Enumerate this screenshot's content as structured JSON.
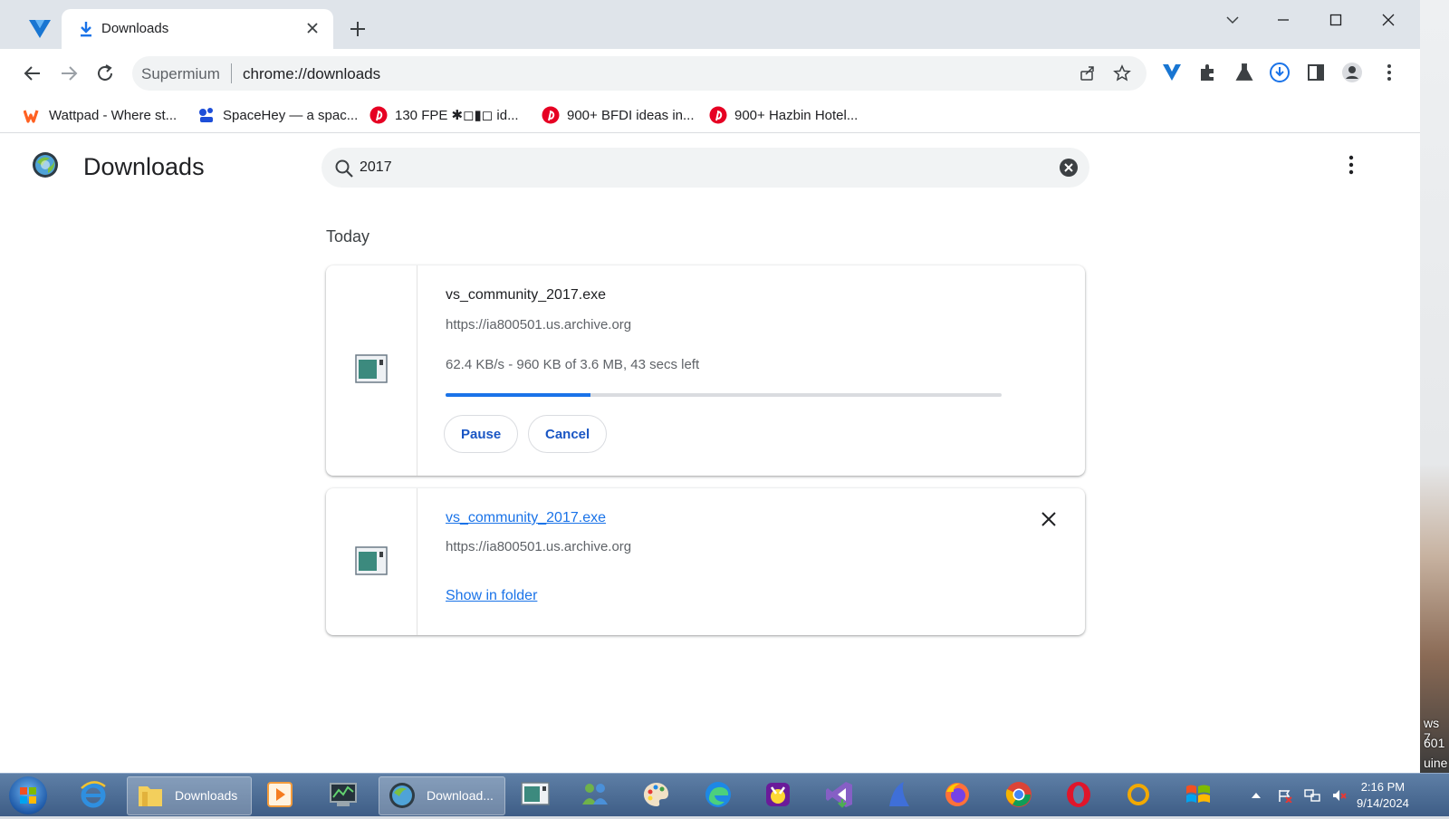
{
  "browser": {
    "tab": {
      "title": "Downloads"
    },
    "omnibox": {
      "site_label": "Supermium",
      "url": "chrome://downloads"
    },
    "bookmarks": [
      {
        "label": "Wattpad - Where st...",
        "icon": "wattpad-icon",
        "color": "#ff6122"
      },
      {
        "label": "SpaceHey — a spac...",
        "icon": "spacehey-icon",
        "color": "#1d4ed8"
      },
      {
        "label": "130 FPE ✱◻▮◻ id...",
        "icon": "pinterest-icon",
        "color": "#e60023"
      },
      {
        "label": "900+ BFDI ideas in...",
        "icon": "pinterest-icon",
        "color": "#e60023"
      },
      {
        "label": "900+ Hazbin Hotel...",
        "icon": "pinterest-icon",
        "color": "#e60023"
      }
    ]
  },
  "page": {
    "title": "Downloads",
    "search": {
      "value": "2017"
    },
    "section_label": "Today",
    "downloads": [
      {
        "filename": "vs_community_2017.exe",
        "url": "https://ia800501.us.archive.org",
        "status": "62.4 KB/s - 960 KB of 3.6 MB, 43 secs left",
        "progress": 0.26,
        "pause_label": "Pause",
        "cancel_label": "Cancel"
      },
      {
        "filename": "vs_community_2017.exe",
        "url": "https://ia800501.us.archive.org",
        "show_in_folder_label": "Show in folder"
      }
    ]
  },
  "desktop": {
    "edge_text": [
      "ws 7",
      "601",
      "uine"
    ]
  },
  "taskbar": {
    "explorer_label": "Downloads",
    "browser_label": "Download...",
    "clock": {
      "time": "2:16 PM",
      "date": "9/14/2024"
    }
  },
  "colors": {
    "accent": "#1a73e8",
    "progress_track": "#dadce0",
    "button_text": "#1a56c4"
  }
}
